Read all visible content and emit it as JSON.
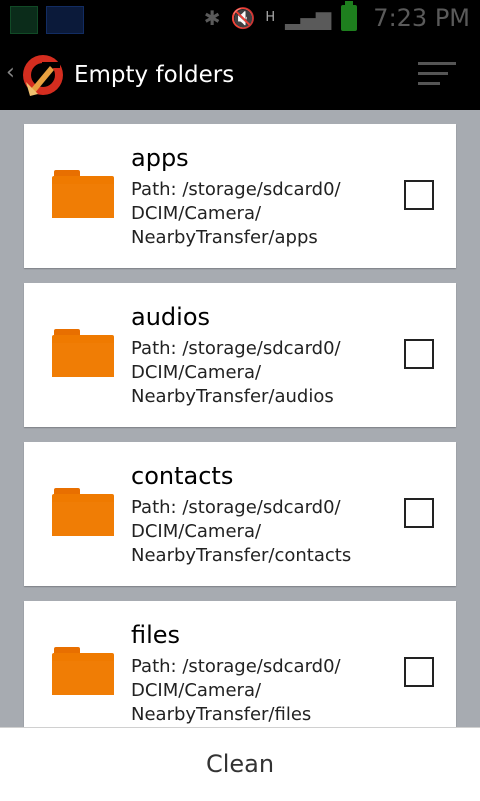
{
  "status_bar": {
    "time": "7:23 PM",
    "network_indicator": "H",
    "icons": [
      "notification-icon-1",
      "notification-icon-2",
      "bluetooth-icon",
      "mute-icon",
      "data-transfer-icon",
      "signal-icon",
      "battery-icon"
    ]
  },
  "action_bar": {
    "title": "Empty folders",
    "logo": "ccleaner-logo",
    "menu_icon": "sort-menu-icon"
  },
  "folders": [
    {
      "name": "apps",
      "path": "Path: /storage/sdcard0/\nDCIM/Camera/\nNearbyTransfer/apps",
      "checked": false
    },
    {
      "name": "audios",
      "path": "Path: /storage/sdcard0/\nDCIM/Camera/\nNearbyTransfer/audios",
      "checked": false
    },
    {
      "name": "contacts",
      "path": "Path: /storage/sdcard0/\nDCIM/Camera/\nNearbyTransfer/contacts",
      "checked": false
    },
    {
      "name": "files",
      "path": "Path: /storage/sdcard0/\nDCIM/Camera/\nNearbyTransfer/files",
      "checked": false
    }
  ],
  "bottom_bar": {
    "clean_label": "Clean"
  },
  "colors": {
    "folder": "#ef7a00",
    "background": "#a7abb1",
    "bar": "#000000"
  }
}
